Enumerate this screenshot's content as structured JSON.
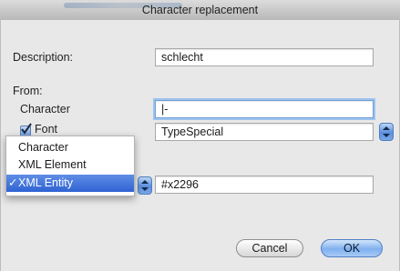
{
  "window": {
    "title": "Character replacement"
  },
  "form": {
    "description_label": "Description:",
    "description_value": "schlecht",
    "from_label": "From:",
    "character_label": "Character",
    "character_value": "|-",
    "font_label": "Font",
    "font_checked": true,
    "font_value": "TypeSpecial",
    "entity_value": "#x2296"
  },
  "type_menu": {
    "items": [
      {
        "label": "Character",
        "selected": false
      },
      {
        "label": "XML Element",
        "selected": false
      },
      {
        "label": "XML Entity",
        "selected": true
      }
    ],
    "checkmark": "✓"
  },
  "buttons": {
    "cancel": "Cancel",
    "ok": "OK"
  },
  "colors": {
    "accent": "#3a6fd8",
    "focus_ring": "#9ec2ee"
  },
  "icons": {
    "checkbox": "checkbox-checked-icon",
    "stepper": "up-down-arrows-icon"
  }
}
